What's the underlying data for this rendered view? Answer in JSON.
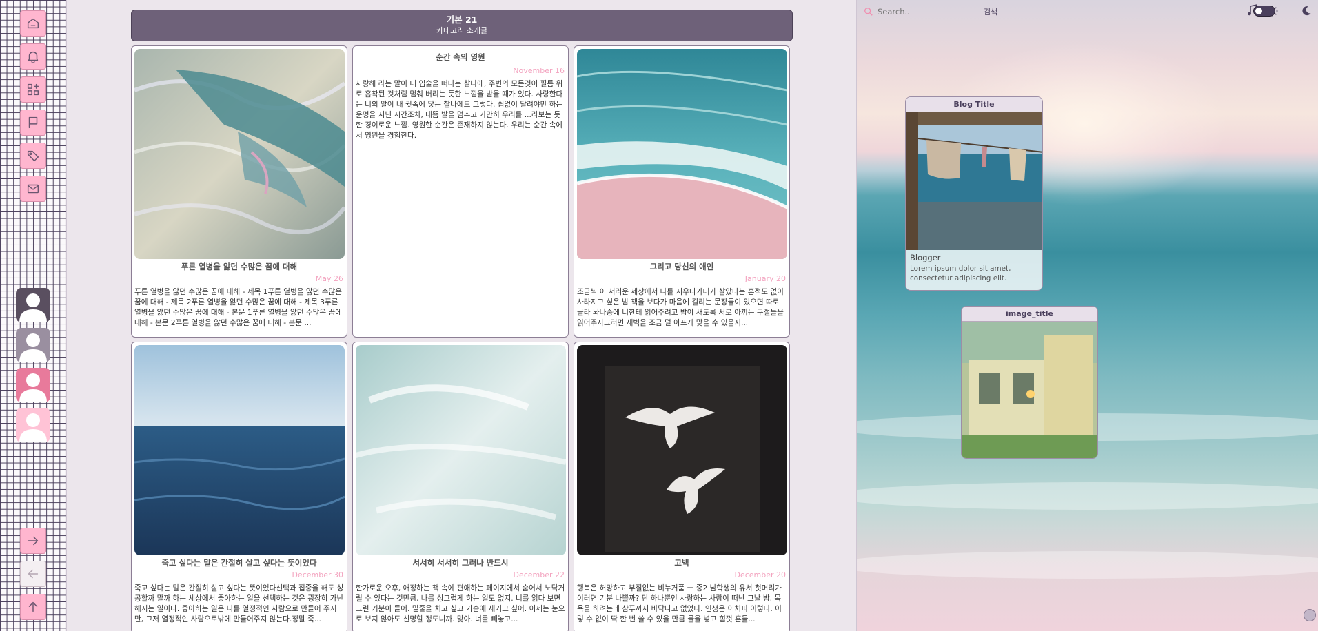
{
  "sidebar": {
    "nav_icons": [
      "home-icon",
      "bell-icon",
      "grid-plus-icon",
      "flag-icon",
      "tags-icon",
      "mail-icon"
    ],
    "bottom_icons": [
      "arrow-right-icon",
      "arrow-left-icon",
      "arrow-up-icon"
    ]
  },
  "header": {
    "title": "기본 21",
    "subtitle": "카테고리 소개글"
  },
  "posts": [
    {
      "title": "푸른 열병을 앓던 수많은 꿈에 대해",
      "date": "May 26",
      "excerpt": "푸른 열병을 앓던 수많은 꿈에 대해 - 제목 1푸른 열병을 앓던 수많은 꿈에 대해 - 제목 2푸른 열병을 앓던 수많은 꿈에 대해 - 제목 3푸른 열병을 앓던 수많은 꿈에 대해 - 본문 1푸른 열병을 앓던 수많은 꿈에 대해 - 본문 2푸른 열병을 앓던 수많은 꿈에 대해 - 본문 ..."
    },
    {
      "title": "순간 속의 영원",
      "date": "November 16",
      "excerpt": "사랑해 라는 말이 내 입술을 떠나는 찰나에, 주변의 모든것이 필름 위로 흡착된 것처럼 멈춰 버리는 듯한 느낌을 받을 때가 있다. 사랑한다는 너의 말이 내 귓속에 닿는 찰나에도 그렇다. 쉼없이 달려야만 하는 운명을 지닌 시간조차, 대뜸 발을 멈추고 가만히 우리를 ...라보는 듯한 경이로운 느낌. 영원한 순간은 존재하지 않는다. 우리는 순간 속에서 영원을 경험한다."
    },
    {
      "title": "그리고 당신의 애인",
      "date": "January 20",
      "excerpt": "조금씩 이 서러운 세상에서 나를 지우다가내가 살았다는 흔적도 없이 사라지고 싶은 밤 책을 보다가 마음에 걸리는 문장들이 있으면 따로 골라 놔나중에 너한테 읽어주려고 밤이 새도록 서로 아끼는 구절들을 읽어주자그러면 새벽을 조금 덜 아프게 맞을 수 있을지..."
    },
    {
      "title": "죽고 싶다는 말은 간절히 살고 싶다는 뜻이었다",
      "date": "December 30",
      "excerpt": "죽고 싶다는 말은 간절히 살고 싶다는 뜻이었다선택과 집중을 해도 성공할까 말까 하는 세상에서 좋아하는 일을 선택하는 것은 굉장히 가난해지는 일이다. 좋아하는 일은 나를 열정적인 사람으로 만들어 주지만, 그저 열정적인 사람으로밖에 만들어주지 않는다.정말 죽..."
    },
    {
      "title": "서서히 서서히 그러나 반드시",
      "date": "December 22",
      "excerpt": "한가로운 오후, 애정하는 책 속에 편애하는 페이지에서 숨어서 노닥거릴 수 있다는 것만큼, 나를 싱그럽게 하는 일도 없지. 너를 읽다 보면 그런 기분이 들어. 밑줄을 치고 싶고 가슴에 새기고 싶어. 이제는 눈으로 보지 않아도 선명할 정도니까. 맞아. 너를 빼놓고..."
    },
    {
      "title": "고백",
      "date": "December 20",
      "excerpt": "행복은 허망하고 부질없는 비누거품 ㅡ 중2 남학생의 유서 첫머리가 이러면 기분 나쁠까? 단 하나뿐인 사랑하는 사람이 떠난 그날 밤, 목욕을 하려는데 샴푸까지 바닥나고 없었다. 인생은 이처피 이렇다. 이렇 수 없이 딱 한 번 쓸 수 있을 만큼 물을 넣고 힘껏 흔들..."
    }
  ],
  "search": {
    "placeholder": "Search..",
    "button_label": "검색"
  },
  "toolbar_icons": [
    "music-icon",
    "sun-icon",
    "theme-toggle",
    "moon-icon"
  ],
  "widgets": {
    "blog": {
      "title": "Blog Title",
      "name": "Blogger",
      "description": "Lorem ipsum dolor sit amet, consectetur adipiscing elit."
    },
    "image": {
      "title": "image_title"
    }
  },
  "colors": {
    "accent_pink": "#ffb6cf",
    "header_purple": "#6e6179",
    "date_pink": "#f3a3bf",
    "grid_line": "#4a3f5c"
  }
}
